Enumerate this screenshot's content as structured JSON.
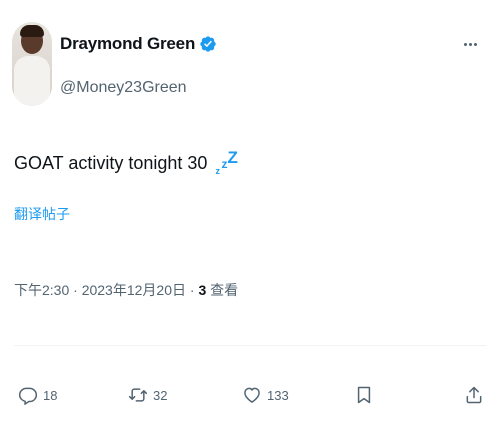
{
  "author": {
    "display_name": "Draymond Green",
    "handle": "@Money23Green",
    "verified": true
  },
  "tweet": {
    "text": "GOAT activity tonight 30",
    "emoji": "zzz-icon",
    "translate_label": "翻译帖子"
  },
  "meta": {
    "time": "下午2:30",
    "separator1": " · ",
    "date": "2023年12月20日",
    "separator2": " · ",
    "views_count": "3",
    "views_label": " 查看"
  },
  "actions": {
    "reply_count": "18",
    "retweet_count": "32",
    "like_count": "133"
  },
  "colors": {
    "accent": "#1d9bf0",
    "text_primary": "#0f1419",
    "text_secondary": "#536471"
  }
}
